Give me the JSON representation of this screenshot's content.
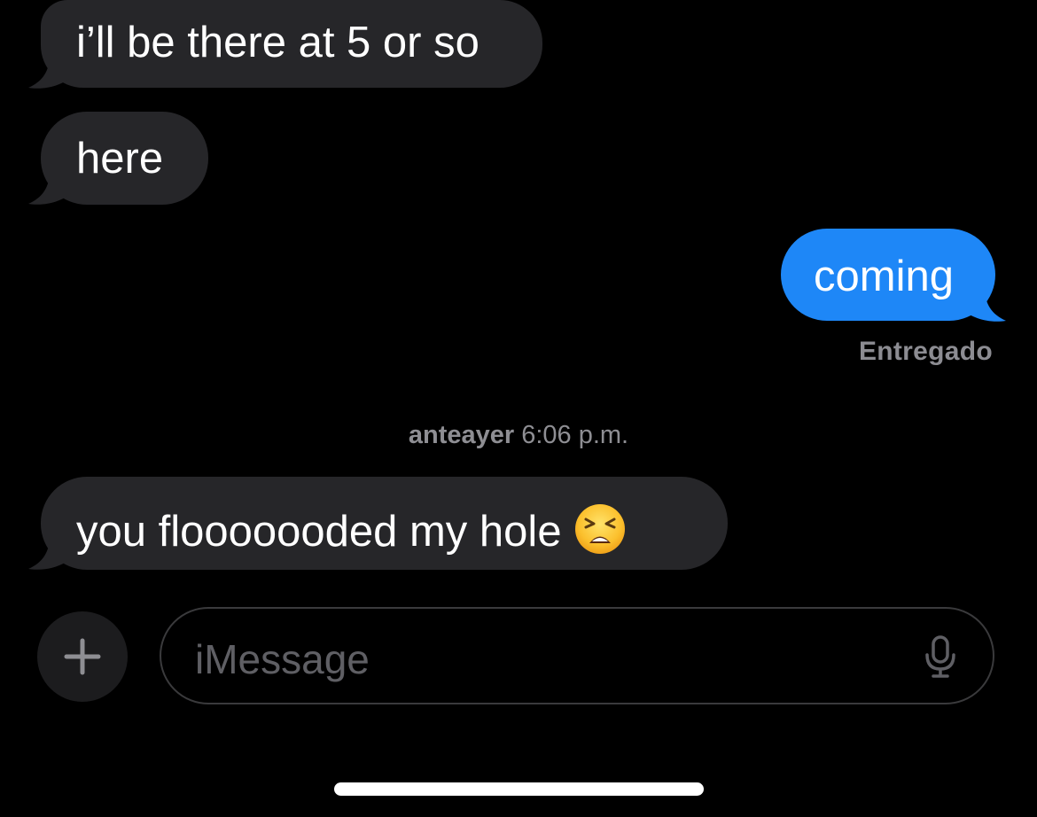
{
  "conversation": {
    "messages": [
      {
        "direction": "received",
        "text": "i’ll be there at 5 or so"
      },
      {
        "direction": "received",
        "text": "here"
      },
      {
        "direction": "sent",
        "text": "coming"
      },
      {
        "direction": "received",
        "text": "you flooooooded my hole"
      }
    ],
    "delivery_status": "Entregado",
    "timestamp": {
      "day": "anteayer",
      "time": "6:06 p.m."
    },
    "emoji": "weary-face"
  },
  "composer": {
    "placeholder": "iMessage",
    "add_icon": "plus-icon",
    "mic_icon": "microphone-icon"
  },
  "colors": {
    "background": "#000000",
    "received_bubble": "#262629",
    "sent_bubble": "#1e87f7",
    "secondary_text": "#8c8c92"
  }
}
